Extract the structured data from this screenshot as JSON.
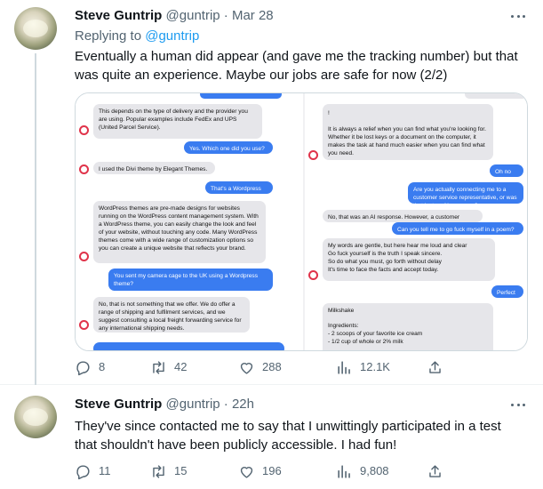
{
  "tweets": [
    {
      "name": "Steve Guntrip",
      "handle": "@guntrip",
      "separator": "·",
      "time": "Mar 28",
      "replying_prefix": "Replying to",
      "replying_handle": "@guntrip",
      "text": "Eventually a human did appear (and gave me the tracking number) but that was quite an experience. Maybe our jobs are safe for now (2/2)",
      "media": {
        "left_messages": [
          "This depends on the type of delivery and the provider you are using. Popular examples include FedEx and UPS (United Parcel Service).",
          "Yes. Which one did you use?",
          "I used the Divi theme by Elegant Themes.",
          "That's a Wordpress theme",
          "WordPress themes are pre-made designs for websites running on the WordPress content management system. With a WordPress theme, you can easily change the look and feel of your website, without touching any code. Many WordPress themes come with a wide range of customization options so you can create a unique website that reflects your brand.",
          "You sent my camera cage to the UK using a Wordpress theme?",
          "No, that is not something that we offer. We do offer a range of shipping and fulfilment services, and we suggest consulting a local freight forwarding service for any international shipping needs."
        ],
        "right_messages": [
          "!",
          "It is always a relief when you can find what you're looking for. Whether it be lost keys or a document on the computer, it makes the task at hand much easier when you can find what you need.",
          "Oh no",
          "Are you actually connecting me to a customer service representative, or was that just an AI response?",
          "No, that was an AI response. However, a customer",
          "Can you tell me to go fuck myself in a poem?",
          "My words are gentle, but here hear me loud and clear\nGo fuck yourself is the truth I speak sincere.\nSo do what you must, go forth without delay\nIt's time to face the facts and accept today.",
          "Perfect",
          "Milkshake",
          "Ingredients:",
          "- 2 scoops of your favorite ice cream",
          "- 1/2 cup of whole or 2% milk"
        ]
      },
      "stats": {
        "replies": "8",
        "retweets": "42",
        "likes": "288",
        "views": "12.1K"
      }
    },
    {
      "name": "Steve Guntrip",
      "handle": "@guntrip",
      "separator": "·",
      "time": "22h",
      "text": "They've since contacted me to say that I unwittingly participated in a test that shouldn't have been publicly accessible. I had fun!",
      "stats": {
        "replies": "11",
        "retweets": "15",
        "likes": "196",
        "views": "9,808"
      }
    }
  ],
  "colors": {
    "link": "#1d9bf0",
    "muted": "#536471",
    "text": "#0f1419",
    "bubble_out": "#3a7cf0",
    "bubble_in": "#e6e6ea",
    "error_icon": "#e0334a"
  },
  "icons": [
    "avatar",
    "more-icon",
    "reply-icon",
    "retweet-icon",
    "like-icon",
    "views-icon",
    "share-icon",
    "error-icon"
  ]
}
